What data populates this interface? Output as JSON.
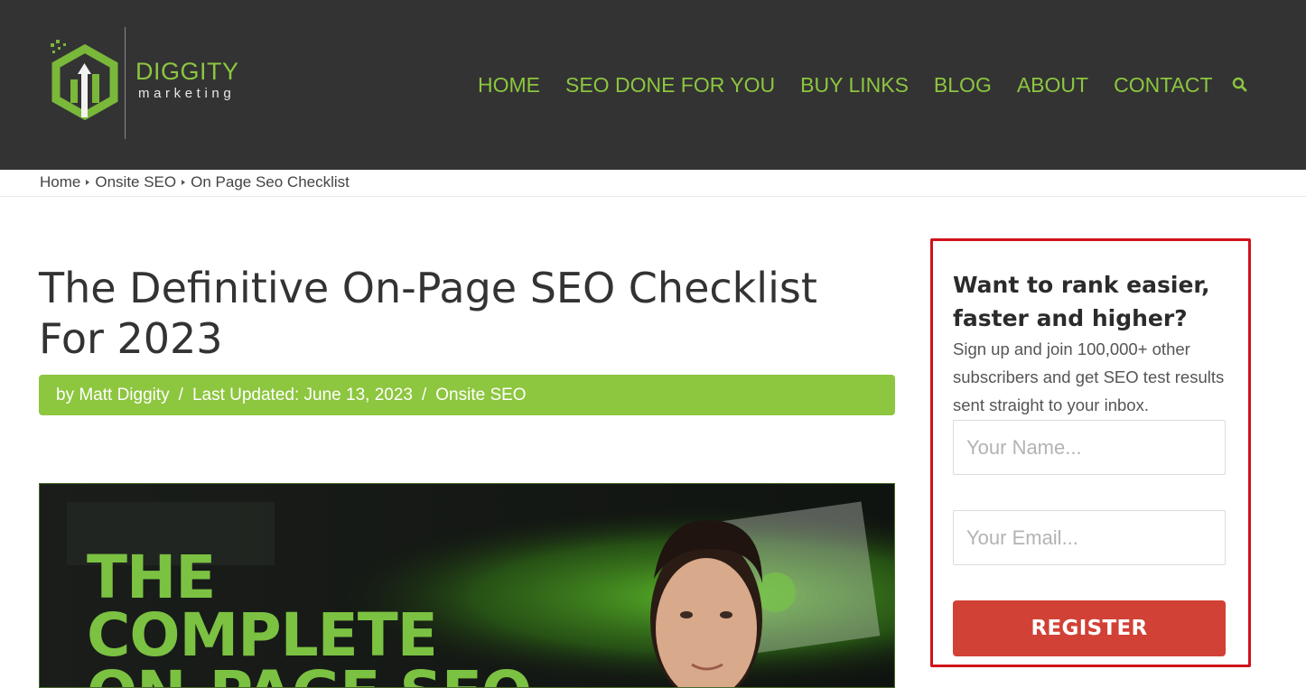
{
  "header": {
    "logo_word": "DIGGITY",
    "logo_sub": "marketing",
    "nav": [
      {
        "label": "HOME"
      },
      {
        "label": "SEO DONE FOR YOU"
      },
      {
        "label": "BUY LINKS"
      },
      {
        "label": "BLOG"
      },
      {
        "label": "ABOUT"
      },
      {
        "label": "CONTACT"
      }
    ],
    "search_icon": "search-icon"
  },
  "breadcrumb": {
    "items": [
      "Home",
      "Onsite SEO",
      "On Page Seo Checklist"
    ]
  },
  "article": {
    "title": "The Definitive On-Page SEO Checklist For 2023",
    "meta": {
      "author": "by Matt Diggity",
      "sep": "/",
      "updated": "Last Updated: June 13, 2023",
      "category": "Onsite SEO"
    },
    "hero": {
      "line1": "THE",
      "line2": "COMPLETE",
      "line3": "ON-PAGE SEO"
    }
  },
  "optin": {
    "heading": "Want to rank easier, faster and higher?",
    "text": "Sign up and join 100,000+ other subscribers and get SEO test results sent straight to your inbox.",
    "name_placeholder": "Your Name...",
    "email_placeholder": "Your Email...",
    "button_label": "REGISTER"
  },
  "colors": {
    "header_bg": "#333333",
    "brand_green": "#8cc63f",
    "register_red": "#d14136",
    "optin_border": "#d0121b"
  }
}
